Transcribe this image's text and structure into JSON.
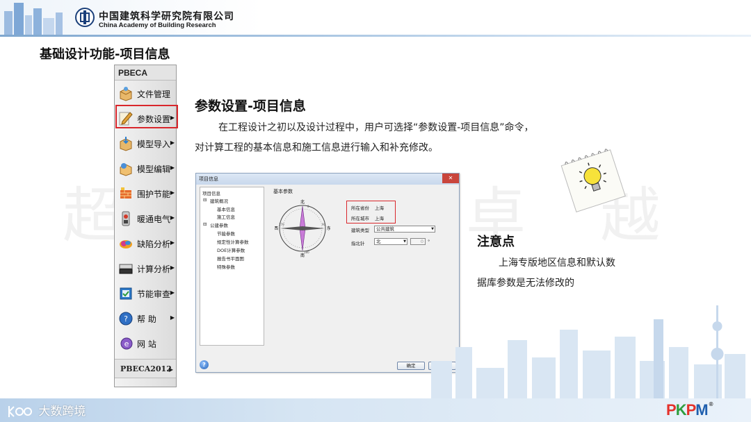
{
  "header": {
    "org_cn": "中国建筑科学研究院有限公司",
    "org_en": "China Academy of Building Research"
  },
  "page_title": "基础设计功能-项目信息",
  "watermark": "超  群    創  卓  越",
  "menu": {
    "title": "PBECA",
    "items": [
      {
        "label": "文件管理",
        "icon": "folder-box-icon",
        "arrow": ""
      },
      {
        "label": "参数设置",
        "icon": "pen-icon",
        "arrow": "▶"
      },
      {
        "label": "模型导入",
        "icon": "import-box-icon",
        "arrow": "▶"
      },
      {
        "label": "模型编辑",
        "icon": "edit-model-icon",
        "arrow": "▶"
      },
      {
        "label": "围护节能",
        "icon": "wall-icon",
        "arrow": "▶"
      },
      {
        "label": "暖通电气",
        "icon": "hvac-icon",
        "arrow": "▶"
      },
      {
        "label": "缺陷分析",
        "icon": "analysis-icon",
        "arrow": "▶"
      },
      {
        "label": "计算分析",
        "icon": "calculator-icon",
        "arrow": "▶"
      },
      {
        "label": "节能审查",
        "icon": "review-icon",
        "arrow": "▶"
      },
      {
        "label": "帮   助",
        "icon": "help-icon",
        "arrow": "▶"
      },
      {
        "label": "网   站",
        "icon": "website-icon",
        "arrow": ""
      }
    ],
    "footer": "PBECA2012",
    "footer_arrow": "▶"
  },
  "section": {
    "title": "参数设置-项目信息",
    "p1": "在工程设计之初以及设计过程中，用户可选择“参数设置-项目信息”命令，",
    "p2": "对计算工程的基本信息和施工信息进行输入和补充修改。"
  },
  "dialog": {
    "title": "项目信息",
    "close": "✕",
    "tree": [
      {
        "label": "项目信息",
        "level": 0
      },
      {
        "label": "建筑概况",
        "level": 1,
        "expander": "⊟"
      },
      {
        "label": "基本信息",
        "level": 2
      },
      {
        "label": "施工信息",
        "level": 2
      },
      {
        "label": "公建参数",
        "level": 1,
        "expander": "⊟"
      },
      {
        "label": "节能参数",
        "level": 2
      },
      {
        "label": "规定性计算参数",
        "level": 2
      },
      {
        "label": "DOE计算参数",
        "level": 2
      },
      {
        "label": "报告书平面图",
        "level": 2
      },
      {
        "label": "特殊参数",
        "level": 2
      }
    ],
    "panel_label": "基本参数",
    "compass": {
      "n": "北",
      "s": "南",
      "e": "东",
      "w": "西",
      "deg": [
        "0",
        "90",
        "180",
        "270"
      ]
    },
    "province_label": "所在省份",
    "province_value": "上海",
    "city_label": "所在城市",
    "city_value": "上海",
    "building_type_label": "建筑类型",
    "building_type_value": "公共建筑",
    "north_label": "指北针",
    "north_value": "北",
    "angle_value": "0",
    "angle_unit": "°",
    "ok": "确定",
    "cancel": "取消",
    "help": "?"
  },
  "notes": {
    "title": "注意点",
    "p1": "上海专版地区信息和默认数",
    "p2": "据库参数是无法修改的"
  },
  "footer": {
    "brand": "大数跨境",
    "pkpm": "PKPM",
    "registered": "®"
  },
  "colors": {
    "highlight_red": "#d9262b",
    "header_blue": "#7fa7cf",
    "pkpm_p": "#e4322b",
    "pkpm_k": "#2f9e3f",
    "pkpm_m": "#1f5fae"
  }
}
